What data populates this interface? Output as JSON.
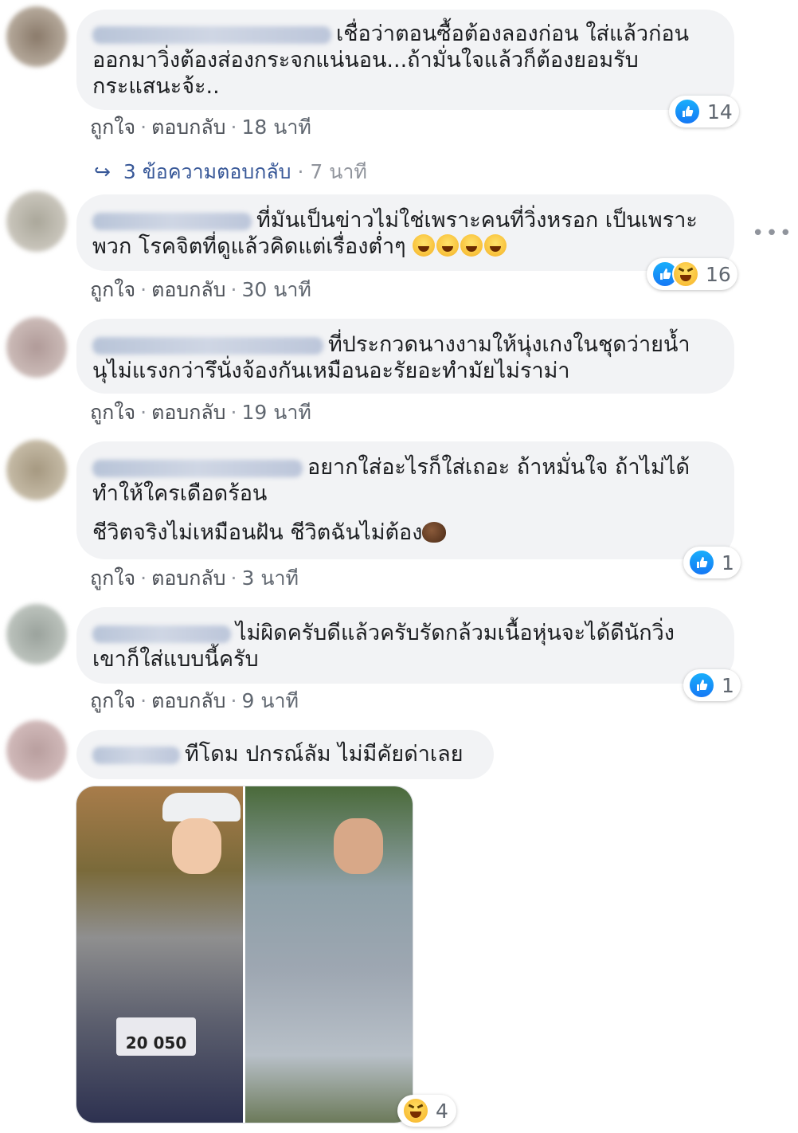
{
  "labels": {
    "like": "ถูกใจ",
    "reply": "ตอบกลับ",
    "dot": "·"
  },
  "comments": [
    {
      "lines": "เชื่อว่าตอนซื้อต้องลองก่อน ใส่แล้วก่อน\nออกมาวิ่งต้องส่องกระจกแน่นอน...ถ้ามั่นใจแล้วก็ต้องยอมรับ\nกระแสนะจ้ะ..",
      "time": "18 นาที",
      "reaction_count": "14",
      "replies": {
        "label": "3 ข้อความตอบกลับ",
        "time": "7 นาที"
      }
    },
    {
      "lines": "ที่มันเป็นข่าวไม่ใช่เพราะคนที่วิ่งหรอก เป็นเพราะ\nพวก โรคจิตที่ดูแล้วคิดแต่เรื่องต่ำๆ",
      "time": "30 นาที",
      "reaction_count": "16"
    },
    {
      "lines": "ที่ประกวดนางงามให้นุ่งเกงในชุดว่ายน้ำ\nนุไม่แรงกว่ารึนั่งจ้องกันเหมือนอะรัยอะทำมัยไม่ราม่า",
      "time": "19 นาที"
    },
    {
      "lines": "อยากใส่อะไรก็ใส่เถอะ ถ้าหมั่นใจ ถ้าไม่ได้\nทำให้ใครเดือดร้อน",
      "line2": "ชีวิตจริงไม่เหมือนฝัน ชีวิตฉันไม่ต้อง",
      "time": "3 นาที",
      "reaction_count": "1"
    },
    {
      "lines": "ไม่ผิดครับดีแล้วครับรัดกล้วมเนื้อหุ่นจะได้ดีนักวิ่ง\nเขาก็ใส่แบบนี้ครับ",
      "time": "9 นาที",
      "reaction_count": "1"
    },
    {
      "lines": "ทีโดม ปกรณ์ลัม ไม่มีคัยด่าเลย",
      "photo_bib": "20 050",
      "reaction_count": "4"
    }
  ],
  "colors": {
    "like_blue": "#1877f2",
    "bubble": "#f2f3f5",
    "link": "#385898"
  },
  "icons": [
    "like-icon",
    "haha-icon",
    "reply-arrow-icon",
    "more-dots-icon"
  ]
}
